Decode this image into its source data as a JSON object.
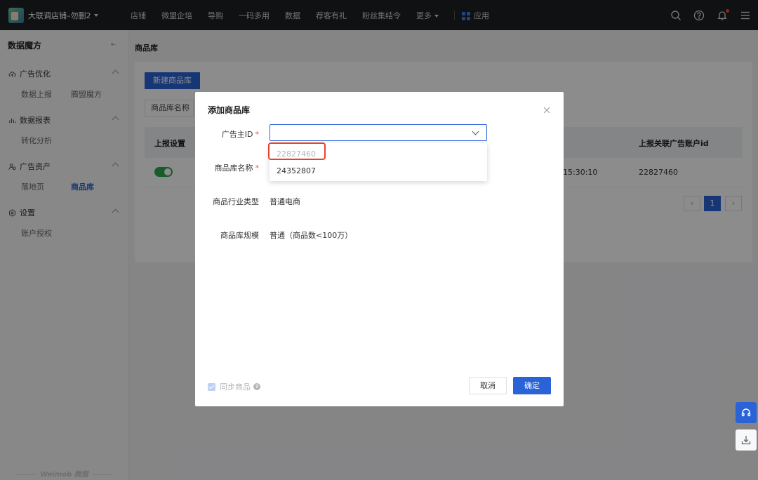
{
  "header": {
    "store_name": "大联调店铺–勿删2",
    "nav": [
      "店铺",
      "微盟企培",
      "导购",
      "一码多用",
      "数据",
      "荐客有礼",
      "粉丝集结令"
    ],
    "more_label": "更多",
    "apps_label": "应用",
    "icons": [
      "search-icon",
      "help-icon",
      "bell-icon",
      "menu-icon"
    ]
  },
  "sidebar": {
    "title": "数据魔方",
    "groups": [
      {
        "label": "广告优化",
        "icon": "cloud-upload-icon",
        "items": [
          "数据上报",
          "腾盟魔方"
        ]
      },
      {
        "label": "数据报表",
        "icon": "bar-chart-icon",
        "items": [
          "转化分析"
        ]
      },
      {
        "label": "广告资产",
        "icon": "people-icon",
        "items": [
          "落地页",
          "商品库"
        ]
      },
      {
        "label": "设置",
        "icon": "hexagon-gear-icon",
        "items": [
          "账户授权"
        ]
      }
    ],
    "active_item": "商品库",
    "brand": "Weimob 微盟"
  },
  "main": {
    "breadcrumb": "商品库",
    "new_button": "新建商品库",
    "filter_label": "商品库名称",
    "table": {
      "col_report": "上报设置",
      "col_account": "上报关联广告账户id",
      "row": {
        "report_enabled": true,
        "time_fragment": "15:30:10",
        "account_id": "22827460"
      }
    },
    "pagination": {
      "current": "1"
    }
  },
  "modal": {
    "title": "添加商品库",
    "advertiser_label": "广告主ID",
    "name_label": "商品库名称",
    "industry_label": "商品行业类型",
    "industry_value": "普通电商",
    "scale_label": "商品库规模",
    "scale_value": "普通（商品数<100万）",
    "advertiser_options": [
      "22827460",
      "24352807"
    ],
    "sync_label": "同步商品",
    "cancel": "取消",
    "confirm": "确定"
  },
  "colors": {
    "primary": "#2a63d8",
    "topbar": "#1d1f24",
    "required": "#f5483b",
    "highlight": "#e8432e",
    "toggle_on": "#2fa84f"
  }
}
